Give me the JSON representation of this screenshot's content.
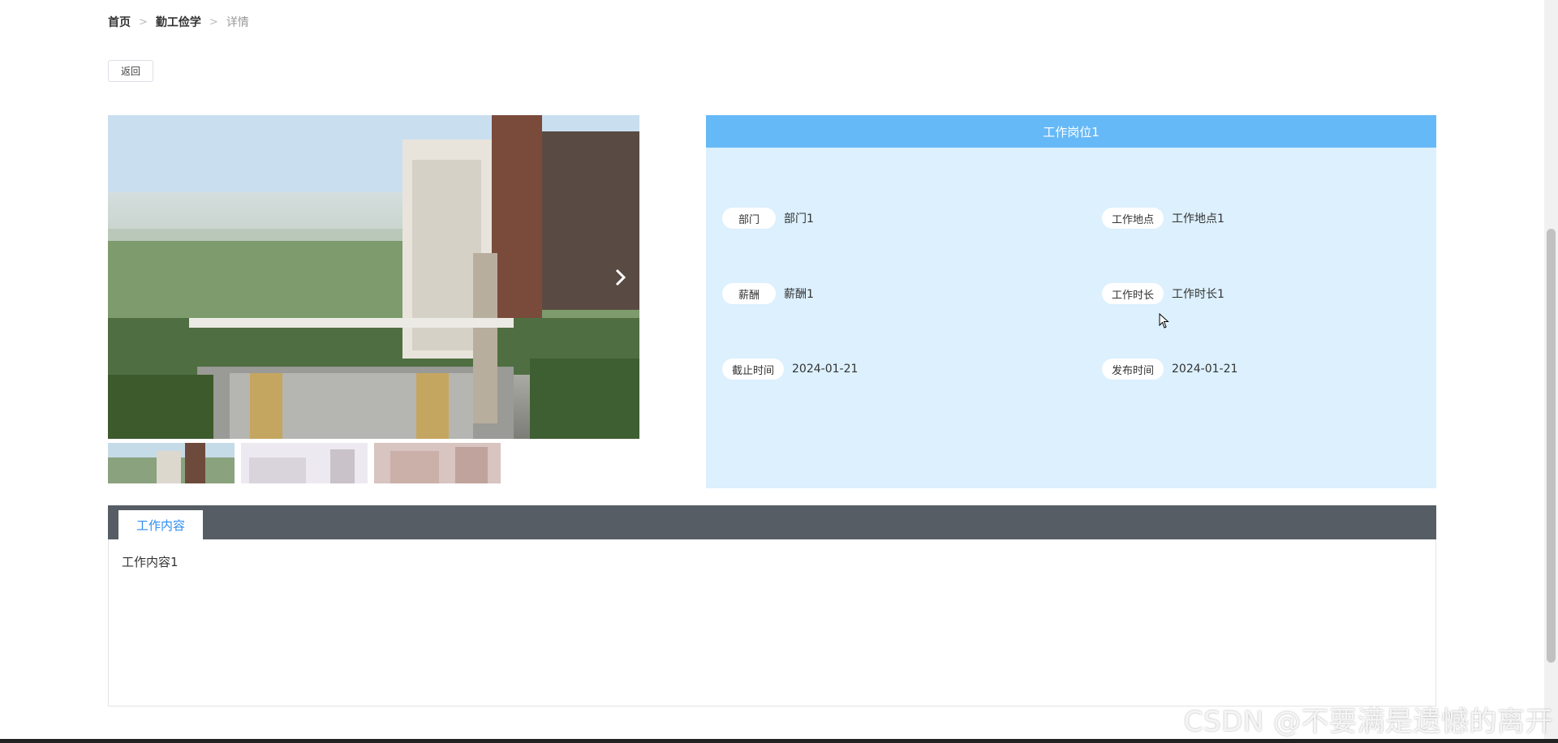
{
  "breadcrumb": {
    "home": "首页",
    "section": "勤工俭学",
    "current": "详情",
    "separator": ">"
  },
  "back_button": "返回",
  "gallery": {
    "next_icon": "chevron-right-icon",
    "thumb_count": 3,
    "current_index": 1
  },
  "job": {
    "title": "工作岗位1",
    "fields": [
      {
        "label": "部门",
        "value": "部门1"
      },
      {
        "label": "工作地点",
        "value": "工作地点1"
      },
      {
        "label": "薪酬",
        "value": "薪酬1"
      },
      {
        "label": "工作时长",
        "value": "工作时长1"
      },
      {
        "label": "截止时间",
        "value": "2024-01-21"
      },
      {
        "label": "发布时间",
        "value": "2024-01-21"
      }
    ]
  },
  "tabs": {
    "active": "工作内容",
    "content": "工作内容1"
  },
  "watermark": "CSDN @不要满是遗憾的离开",
  "colors": {
    "header_blue": "#66b9f7",
    "panel_bg": "#dcf0fd",
    "tab_bar": "#565d64",
    "tab_text": "#2d8cf0"
  }
}
